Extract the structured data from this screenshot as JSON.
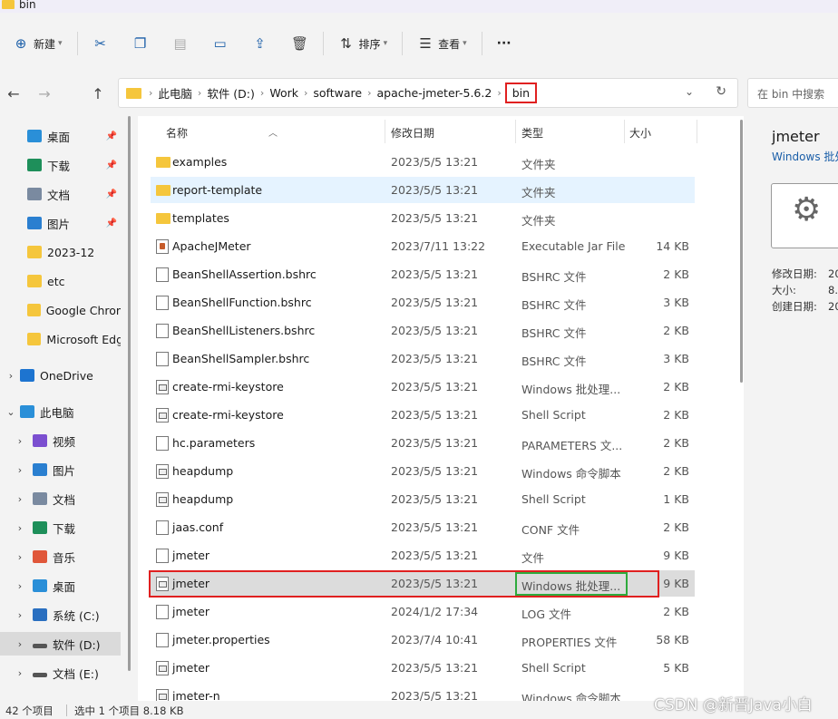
{
  "window": {
    "title": "bin"
  },
  "toolbar": {
    "new_label": "新建",
    "sort_label": "排序",
    "view_label": "查看",
    "more_label": "···"
  },
  "address": {
    "crumbs": [
      "此电脑",
      "软件 (D:)",
      "Work",
      "software",
      "apache-jmeter-5.6.2"
    ],
    "current": "bin",
    "search_placeholder": "在 bin 中搜索"
  },
  "sidebar": {
    "items": [
      {
        "label": "桌面",
        "icon": "desktop-icon",
        "color": "#2a8fd8",
        "pinned": true
      },
      {
        "label": "下载",
        "icon": "download-icon",
        "color": "#1e8f5a",
        "pinned": true
      },
      {
        "label": "文档",
        "icon": "document-icon",
        "color": "#7a8aa0",
        "pinned": true
      },
      {
        "label": "图片",
        "icon": "picture-icon",
        "color": "#2a7fd0",
        "pinned": true
      },
      {
        "label": "2023-12",
        "icon": "folder-icon",
        "color": "#f5c63c"
      },
      {
        "label": "etc",
        "icon": "folder-icon",
        "color": "#f5c63c"
      },
      {
        "label": "Google Chrom",
        "icon": "folder-icon",
        "color": "#f5c63c"
      },
      {
        "label": "Microsoft Edg",
        "icon": "folder-icon",
        "color": "#f5c63c"
      },
      {
        "label": "OneDrive",
        "icon": "cloud-icon",
        "color": "#1d74d0"
      },
      {
        "label": "此电脑",
        "icon": "computer-icon",
        "color": "#2a8fd8"
      },
      {
        "label": "视频",
        "icon": "video-icon",
        "color": "#7b4fd0"
      },
      {
        "label": "图片",
        "icon": "picture-icon",
        "color": "#2a7fd0"
      },
      {
        "label": "文档",
        "icon": "document-icon",
        "color": "#7a8aa0"
      },
      {
        "label": "下载",
        "icon": "download-icon",
        "color": "#1e8f5a"
      },
      {
        "label": "音乐",
        "icon": "music-icon",
        "color": "#e0573a"
      },
      {
        "label": "桌面",
        "icon": "desktop-icon",
        "color": "#2a8fd8"
      },
      {
        "label": "系统 (C:)",
        "icon": "windows-drive-icon",
        "color": "#2a6fc0"
      },
      {
        "label": "软件 (D:)",
        "icon": "drive-icon",
        "color": "#555555"
      },
      {
        "label": "文档 (E:)",
        "icon": "drive-icon",
        "color": "#555555"
      }
    ]
  },
  "columns": {
    "name": "名称",
    "date": "修改日期",
    "type": "类型",
    "size": "大小"
  },
  "files": [
    {
      "name": "examples",
      "date": "2023/5/5 13:21",
      "type": "文件夹",
      "size": "",
      "kind": "folder"
    },
    {
      "name": "report-template",
      "date": "2023/5/5 13:21",
      "type": "文件夹",
      "size": "",
      "kind": "folder"
    },
    {
      "name": "templates",
      "date": "2023/5/5 13:21",
      "type": "文件夹",
      "size": "",
      "kind": "folder"
    },
    {
      "name": "ApacheJMeter",
      "date": "2023/7/11 13:22",
      "type": "Executable Jar File",
      "size": "14 KB",
      "kind": "jar"
    },
    {
      "name": "BeanShellAssertion.bshrc",
      "date": "2023/5/5 13:21",
      "type": "BSHRC 文件",
      "size": "2 KB",
      "kind": "doc"
    },
    {
      "name": "BeanShellFunction.bshrc",
      "date": "2023/5/5 13:21",
      "type": "BSHRC 文件",
      "size": "3 KB",
      "kind": "doc"
    },
    {
      "name": "BeanShellListeners.bshrc",
      "date": "2023/5/5 13:21",
      "type": "BSHRC 文件",
      "size": "2 KB",
      "kind": "doc"
    },
    {
      "name": "BeanShellSampler.bshrc",
      "date": "2023/5/5 13:21",
      "type": "BSHRC 文件",
      "size": "3 KB",
      "kind": "doc"
    },
    {
      "name": "create-rmi-keystore",
      "date": "2023/5/5 13:21",
      "type": "Windows 批处理...",
      "size": "2 KB",
      "kind": "bat"
    },
    {
      "name": "create-rmi-keystore",
      "date": "2023/5/5 13:21",
      "type": "Shell Script",
      "size": "2 KB",
      "kind": "bat"
    },
    {
      "name": "hc.parameters",
      "date": "2023/5/5 13:21",
      "type": "PARAMETERS 文...",
      "size": "2 KB",
      "kind": "doc"
    },
    {
      "name": "heapdump",
      "date": "2023/5/5 13:21",
      "type": "Windows 命令脚本",
      "size": "2 KB",
      "kind": "bat"
    },
    {
      "name": "heapdump",
      "date": "2023/5/5 13:21",
      "type": "Shell Script",
      "size": "1 KB",
      "kind": "bat"
    },
    {
      "name": "jaas.conf",
      "date": "2023/5/5 13:21",
      "type": "CONF 文件",
      "size": "2 KB",
      "kind": "doc"
    },
    {
      "name": "jmeter",
      "date": "2023/5/5 13:21",
      "type": "文件",
      "size": "9 KB",
      "kind": "doc"
    },
    {
      "name": "jmeter",
      "date": "2023/5/5 13:21",
      "type": "Windows 批处理...",
      "size": "9 KB",
      "kind": "bat"
    },
    {
      "name": "jmeter",
      "date": "2024/1/2 17:34",
      "type": "LOG 文件",
      "size": "2 KB",
      "kind": "doc"
    },
    {
      "name": "jmeter.properties",
      "date": "2023/7/4 10:41",
      "type": "PROPERTIES 文件",
      "size": "58 KB",
      "kind": "doc"
    },
    {
      "name": "jmeter",
      "date": "2023/5/5 13:21",
      "type": "Shell Script",
      "size": "5 KB",
      "kind": "bat"
    },
    {
      "name": "jmeter-n",
      "date": "2023/5/5 13:21",
      "type": "Windows 命令脚本",
      "size": "",
      "kind": "bat"
    }
  ],
  "details": {
    "title": "jmeter",
    "subtitle": "Windows 批处",
    "modified_label": "修改日期:",
    "modified_value": "20",
    "size_label": "大小:",
    "size_value": "8.",
    "created_label": "创建日期:",
    "created_value": "20"
  },
  "status": {
    "count": "42 个项目",
    "selection": "选中 1 个项目 8.18 KB"
  },
  "watermark": "CSDN @新晋Java小白"
}
